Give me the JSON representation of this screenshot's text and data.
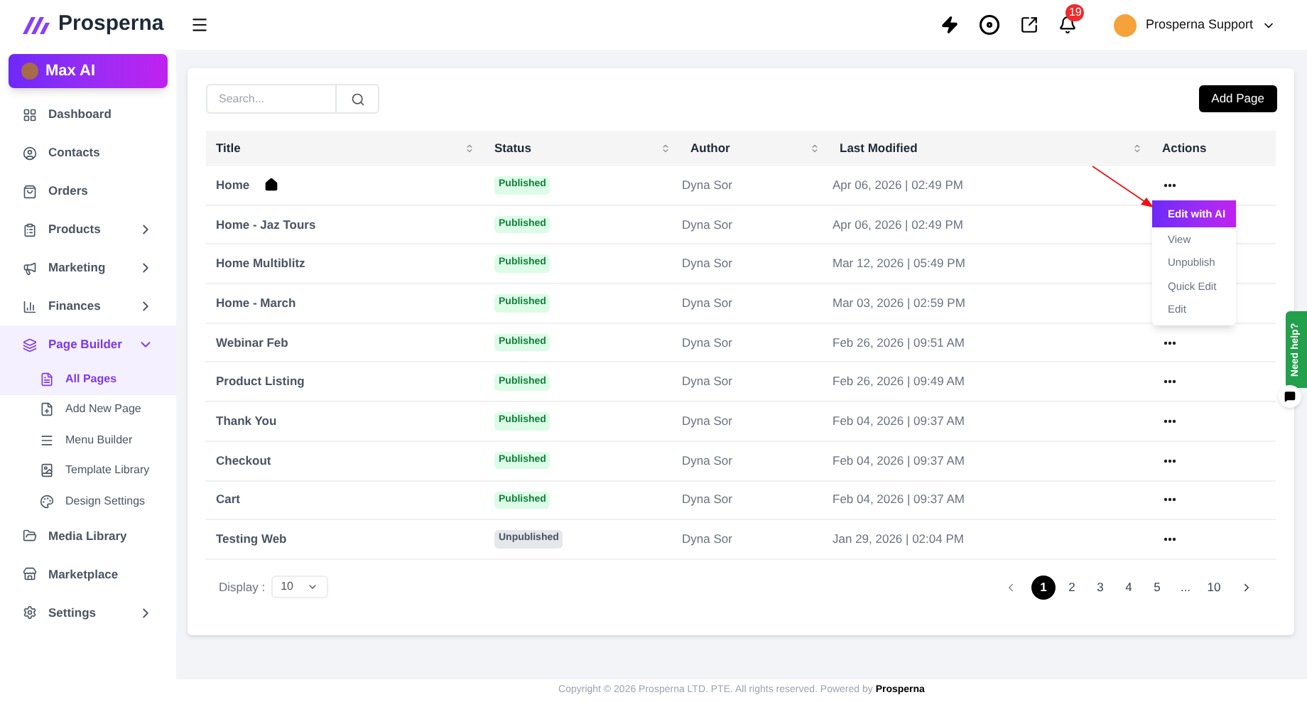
{
  "brand": {
    "name": "Prosperna"
  },
  "ai_button": {
    "label": "Max AI"
  },
  "sidebar": {
    "items": [
      {
        "label": "Dashboard",
        "selected": false
      },
      {
        "label": "Contacts",
        "selected": false
      },
      {
        "label": "Orders",
        "selected": false
      },
      {
        "label": "Products",
        "selected": false,
        "expanded": false
      },
      {
        "label": "Marketing",
        "selected": false,
        "expanded": false
      },
      {
        "label": "Finances",
        "selected": false,
        "expanded": false
      },
      {
        "label": "Page Builder",
        "selected": true,
        "expanded": true,
        "children": [
          {
            "label": "All Pages",
            "selected": true
          },
          {
            "label": "Add New Page",
            "selected": false
          },
          {
            "label": "Menu Builder",
            "selected": false
          },
          {
            "label": "Template Library",
            "selected": false
          },
          {
            "label": "Design Settings",
            "selected": false
          }
        ]
      },
      {
        "label": "Media Library",
        "selected": false
      },
      {
        "label": "Marketplace",
        "selected": false
      },
      {
        "label": "Settings",
        "selected": false,
        "expanded": false
      }
    ]
  },
  "header": {
    "notification_count": "19",
    "user": "Prosperna Support"
  },
  "search": {
    "placeholder": "Search..."
  },
  "add_button": "Add Page",
  "table": {
    "columns": [
      {
        "label": "Title",
        "sortable": true
      },
      {
        "label": "Status",
        "sortable": true
      },
      {
        "label": "Author",
        "sortable": true
      },
      {
        "label": "Last Modified",
        "sortable": true
      },
      {
        "label": "Actions",
        "sortable": false
      }
    ],
    "rows": [
      {
        "title": "Home",
        "home": true,
        "status": "Published",
        "kind": "published",
        "author": "Dyna Sor",
        "modified": "Apr 06, 2026 | 02:49 PM"
      },
      {
        "title": "Home - Jaz Tours",
        "home": false,
        "status": "Published",
        "kind": "published",
        "author": "Dyna Sor",
        "modified": "Apr 06, 2026 | 02:49 PM"
      },
      {
        "title": "Home Multiblitz",
        "home": false,
        "status": "Published",
        "kind": "published",
        "author": "Dyna Sor",
        "modified": "Mar 12, 2026 | 05:49 PM"
      },
      {
        "title": "Home - March",
        "home": false,
        "status": "Published",
        "kind": "published",
        "author": "Dyna Sor",
        "modified": "Mar 03, 2026 | 02:59 PM"
      },
      {
        "title": "Webinar Feb",
        "home": false,
        "status": "Published",
        "kind": "published",
        "author": "Dyna Sor",
        "modified": "Feb 26, 2026 | 09:51 AM"
      },
      {
        "title": "Product Listing",
        "home": false,
        "status": "Published",
        "kind": "published",
        "author": "Dyna Sor",
        "modified": "Feb 26, 2026 | 09:49 AM"
      },
      {
        "title": "Thank You",
        "home": false,
        "status": "Published",
        "kind": "published",
        "author": "Dyna Sor",
        "modified": "Feb 04, 2026 | 09:37 AM"
      },
      {
        "title": "Checkout",
        "home": false,
        "status": "Published",
        "kind": "published",
        "author": "Dyna Sor",
        "modified": "Feb 04, 2026 | 09:37 AM"
      },
      {
        "title": "Cart",
        "home": false,
        "status": "Published",
        "kind": "published",
        "author": "Dyna Sor",
        "modified": "Feb 04, 2026 | 09:37 AM"
      },
      {
        "title": "Testing Web",
        "home": false,
        "status": "Unpublished",
        "kind": "unpublished",
        "author": "Dyna Sor",
        "modified": "Jan 29, 2026 | 02:04 PM"
      }
    ]
  },
  "action_menu": {
    "items": [
      {
        "label": "Edit with AI",
        "selected": true
      },
      {
        "label": "View",
        "selected": false
      },
      {
        "label": "Unpublish",
        "selected": false
      },
      {
        "label": "Quick Edit",
        "selected": false
      },
      {
        "label": "Edit",
        "selected": false
      }
    ]
  },
  "display": {
    "label": "Display :",
    "value": "10"
  },
  "pagination": {
    "pages": [
      {
        "label": "1",
        "selected": true
      },
      {
        "label": "2",
        "selected": false
      },
      {
        "label": "3",
        "selected": false
      },
      {
        "label": "4",
        "selected": false
      },
      {
        "label": "5",
        "selected": false
      },
      {
        "label": "...",
        "selected": false
      },
      {
        "label": "10",
        "selected": false
      }
    ]
  },
  "help_tab": "Need help?",
  "footer": {
    "text": "Copyright © 2026 Prosperna LTD. PTE. All rights reserved. Powered by ",
    "brand": "Prosperna"
  }
}
